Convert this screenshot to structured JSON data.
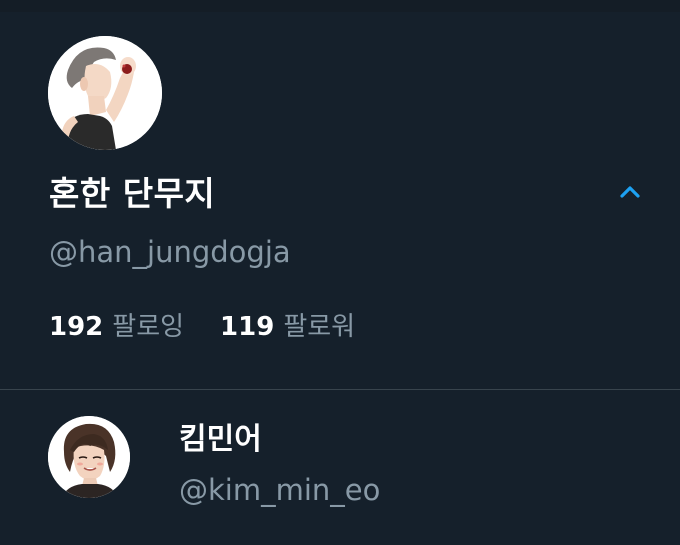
{
  "profile": {
    "display_name": "혼한 단무지",
    "handle": "@han_jungdogja",
    "following_count": "192",
    "following_label": "팔로잉",
    "followers_count": "119",
    "followers_label": "팔로워",
    "avatar_icon": "avatar-illustration"
  },
  "header": {
    "collapse_icon": "chevron-up-icon"
  },
  "accounts": [
    {
      "display_name": "킴민어",
      "handle": "@kim_min_eo",
      "avatar_icon": "avatar-illustration"
    }
  ],
  "colors": {
    "background": "#15202b",
    "primary_text": "#ffffff",
    "secondary_text": "#8899a6",
    "accent": "#1da1f2",
    "divider": "#38444d"
  }
}
